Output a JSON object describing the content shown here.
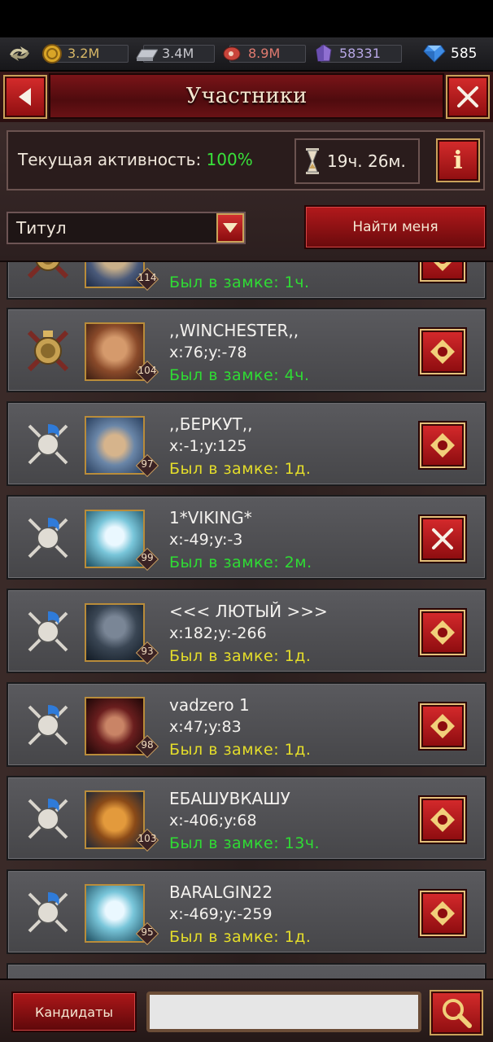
{
  "resources": [
    {
      "name": "gold",
      "icon": "gold-coin-icon",
      "value": "3.2M",
      "color": "#d9a527"
    },
    {
      "name": "iron",
      "icon": "iron-ingot-icon",
      "value": "3.4M",
      "color": "#b9bcc4"
    },
    {
      "name": "food",
      "icon": "meat-icon",
      "value": "8.9M",
      "color": "#d4574a"
    },
    {
      "name": "stone",
      "icon": "crystal-icon",
      "value": "58331",
      "color": "#8f6fd1"
    }
  ],
  "gems": {
    "icon": "gem-icon",
    "value": "585"
  },
  "header": {
    "title": "Участники"
  },
  "activity": {
    "label": "Текущая активность:",
    "value": "100%",
    "timer": "19ч. 26м."
  },
  "info_button": {
    "label": "i"
  },
  "filter": {
    "selected": "Титул"
  },
  "find_me_label": "Найти меня",
  "members": [
    {
      "name": "",
      "coords": "",
      "seen": "Был в замке: 1ч.",
      "seen_color": "green",
      "level": "114",
      "rank_icon": "gold-crest-icon",
      "avatar": "skull-warrior-avatar",
      "action": "teleport-icon"
    },
    {
      "name": ",,WINCHESTER,,",
      "coords": "x:76;y:-78",
      "seen": "Был в замке: 4ч.",
      "seen_color": "green",
      "level": "104",
      "rank_icon": "gold-crest-icon",
      "avatar": "bearded-warrior-avatar",
      "action": "teleport-icon"
    },
    {
      "name": ",,БЕРКУТ,,",
      "coords": "x:-1;y:125",
      "seen": "Был в замке: 1д.",
      "seen_color": "yellow",
      "level": "97",
      "rank_icon": "blue-helmet-icon",
      "avatar": "knight-avatar",
      "action": "teleport-icon"
    },
    {
      "name": "1*VIKING*",
      "coords": "x:-49;y:-3",
      "seen": "Был в замке: 2м.",
      "seen_color": "green",
      "level": "99",
      "rank_icon": "blue-helmet-icon",
      "avatar": "ghost-avatar",
      "action": "close-icon"
    },
    {
      "name": "<<< ЛЮТЫЙ >>>",
      "coords": "x:182;y:-266",
      "seen": "Был в замке: 1д.",
      "seen_color": "yellow",
      "level": "93",
      "rank_icon": "blue-helmet-icon",
      "avatar": "dark-knight-avatar",
      "action": "teleport-icon"
    },
    {
      "name": "vadzero 1",
      "coords": "x:47;y:83",
      "seen": "Был в замке: 1д.",
      "seen_color": "yellow",
      "level": "98",
      "rank_icon": "blue-helmet-icon",
      "avatar": "hooded-woman-avatar",
      "action": "teleport-icon"
    },
    {
      "name": "ЕБАШУВКАШУ",
      "coords": "x:-406;y:68",
      "seen": "Был в замке: 13ч.",
      "seen_color": "green",
      "level": "103",
      "rank_icon": "blue-helmet-icon",
      "avatar": "pumpkin-avatar",
      "action": "teleport-icon"
    },
    {
      "name": "BARALGIN22",
      "coords": "x:-469;y:-259",
      "seen": "Был в замке: 1д.",
      "seen_color": "yellow",
      "level": "95",
      "rank_icon": "blue-helmet-icon",
      "avatar": "ghost-avatar",
      "action": "teleport-icon"
    }
  ],
  "bottom": {
    "candidates_label": "Кандидаты",
    "search_placeholder": ""
  }
}
